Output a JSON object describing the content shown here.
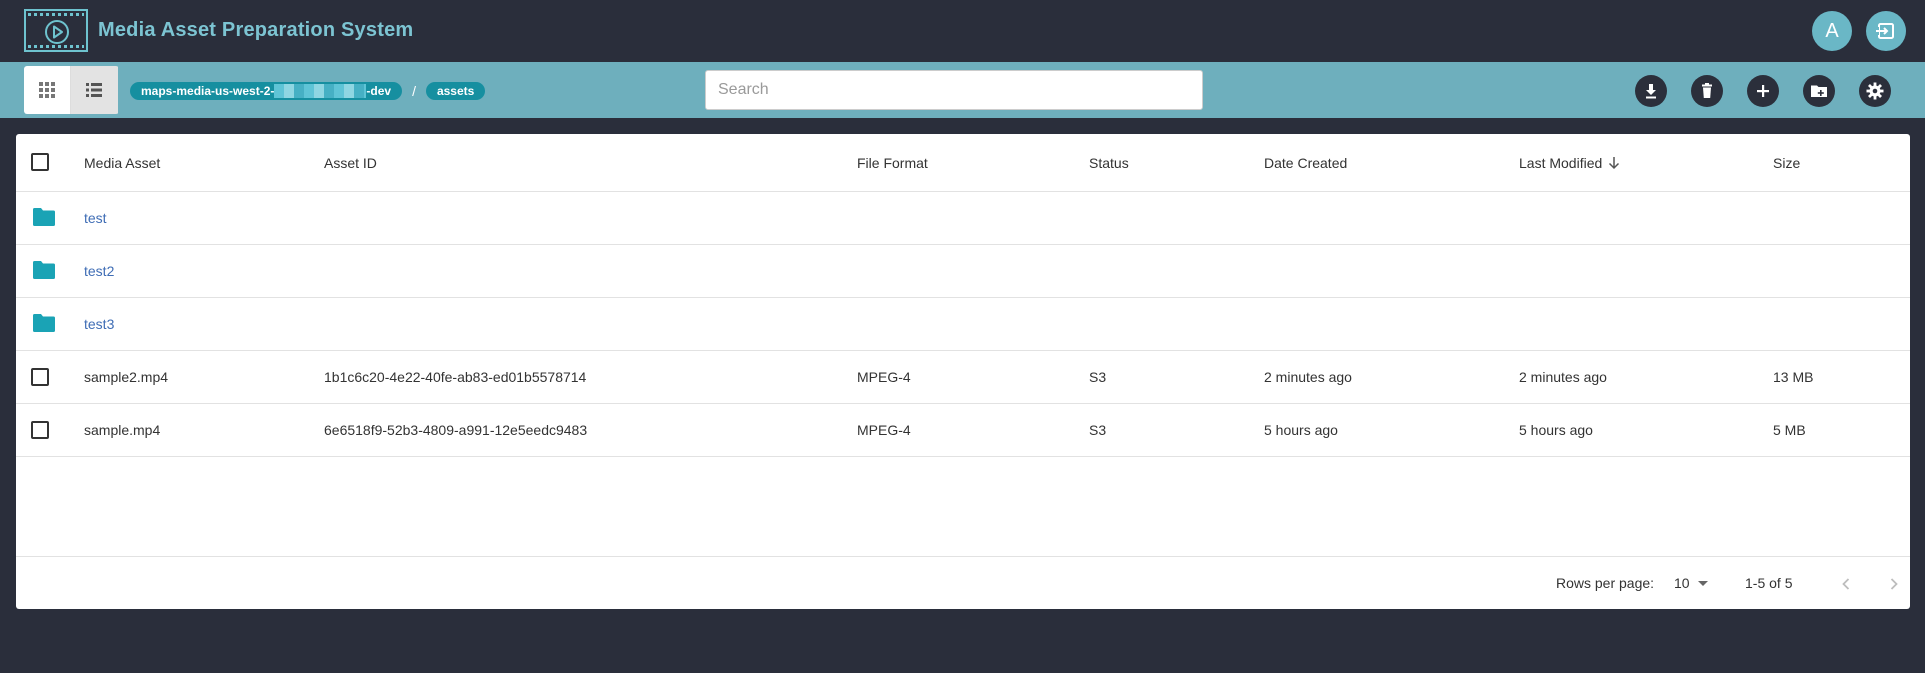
{
  "header": {
    "title": "Media Asset Preparation System",
    "avatar_letter": "A"
  },
  "toolbar": {
    "breadcrumbs": [
      {
        "prefix": "maps-media-us-west-2-",
        "suffix": "-dev"
      },
      {
        "label": "assets"
      }
    ],
    "separator": "/",
    "search_placeholder": "Search"
  },
  "table": {
    "columns": [
      "Media Asset",
      "Asset ID",
      "File Format",
      "Status",
      "Date Created",
      "Last Modified",
      "Size"
    ],
    "folders": [
      "test",
      "test2",
      "test3"
    ],
    "files": [
      {
        "name": "sample2.mp4",
        "asset_id": "1b1c6c20-4e22-40fe-ab83-ed01b5578714",
        "format": "MPEG-4",
        "status": "S3",
        "created": "2 minutes ago",
        "modified": "2 minutes ago",
        "size": "13 MB"
      },
      {
        "name": "sample.mp4",
        "asset_id": "6e6518f9-52b3-4809-a991-12e5eedc9483",
        "format": "MPEG-4",
        "status": "S3",
        "created": "5 hours ago",
        "modified": "5 hours ago",
        "size": "5 MB"
      }
    ]
  },
  "pagination": {
    "rows_label": "Rows per page:",
    "rows_value": "10",
    "range": "1-5 of 5"
  },
  "colors": {
    "header_bg": "#2a2e3b",
    "toolbar_bg": "#6eafbd",
    "accent": "#168fa0",
    "folder": "#1aa3b5",
    "link": "#3f6db5"
  },
  "icons": [
    "film-play-icon",
    "logout-icon",
    "grid-view-icon",
    "list-view-icon",
    "download-icon",
    "delete-icon",
    "add-icon",
    "new-folder-icon",
    "settings-icon",
    "folder-icon",
    "sort-down-icon",
    "chevron-left-icon",
    "chevron-right-icon"
  ]
}
